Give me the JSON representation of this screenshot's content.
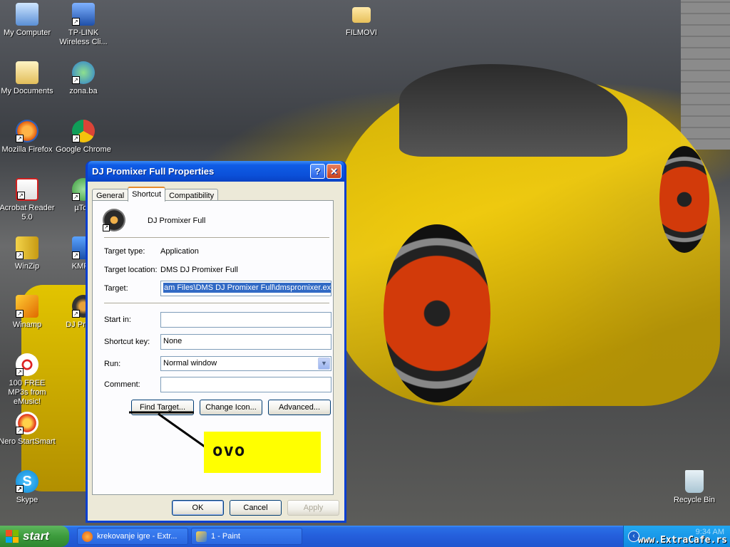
{
  "desktop_icons": [
    {
      "label": "My Computer",
      "icon": "computer-icon"
    },
    {
      "label": "TP-LINK Wireless Cli...",
      "icon": "wireless-icon"
    },
    {
      "label": "FILMOVI",
      "icon": "folder-icon"
    },
    {
      "label": "My Documents",
      "icon": "documents-icon"
    },
    {
      "label": "zona.ba",
      "icon": "globe-icon"
    },
    {
      "label": "Mozilla Firefox",
      "icon": "firefox-icon"
    },
    {
      "label": "Google Chrome",
      "icon": "chrome-icon"
    },
    {
      "label": "Acrobat Reader 5.0",
      "icon": "acrobat-icon"
    },
    {
      "label": "µTorr",
      "icon": "utorrent-icon"
    },
    {
      "label": "WinZip",
      "icon": "winzip-icon"
    },
    {
      "label": "KMPla",
      "icon": "kmplayer-icon"
    },
    {
      "label": "Winamp",
      "icon": "winamp-icon"
    },
    {
      "label": "DJ Pro Fu",
      "icon": "dj-promixer-icon"
    },
    {
      "label": "100 FREE MP3s from eMusic!",
      "icon": "emusic-icon"
    },
    {
      "label": "Nero StartSmart",
      "icon": "nero-icon"
    },
    {
      "label": "Skype",
      "icon": "skype-icon"
    },
    {
      "label": "Recycle Bin",
      "icon": "recycle-bin-icon"
    }
  ],
  "dialog": {
    "title": "DJ Promixer Full Properties",
    "help_glyph": "?",
    "close_glyph": "✕",
    "tabs": [
      "General",
      "Shortcut",
      "Compatibility"
    ],
    "active_tab": "Shortcut",
    "shortcut_name": "DJ Promixer Full",
    "target_type_label": "Target type:",
    "target_type_value": "Application",
    "target_location_label": "Target location:",
    "target_location_value": "DMS DJ Promixer Full",
    "target_label": "Target:",
    "target_value": "am Files\\DMS DJ Promixer Full\\dmspromixer.exe\"",
    "start_in_label": "Start in:",
    "start_in_value": "",
    "shortcut_key_label": "Shortcut key:",
    "shortcut_key_value": "None",
    "run_label": "Run:",
    "run_value": "Normal window",
    "comment_label": "Comment:",
    "comment_value": "",
    "find_target_label": "Find Target...",
    "change_icon_label": "Change Icon...",
    "advanced_label": "Advanced...",
    "ok_label": "OK",
    "cancel_label": "Cancel",
    "apply_label": "Apply"
  },
  "annotation": {
    "text": "ovo",
    "color": "#ffff00"
  },
  "taskbar": {
    "start_label": "start",
    "items": [
      {
        "label": "krekovanje igre - Extr...",
        "icon": "firefox-icon"
      },
      {
        "label": "1 - Paint",
        "icon": "paint-icon"
      }
    ],
    "clock": "9:34 AM",
    "watermark": "www.ExtraCafe.rs"
  },
  "colors": {
    "xp_blue": "#0a3fd0",
    "start_green": "#3c9b3c",
    "tab_accent": "#e68b2c",
    "selection": "#316ac5"
  }
}
